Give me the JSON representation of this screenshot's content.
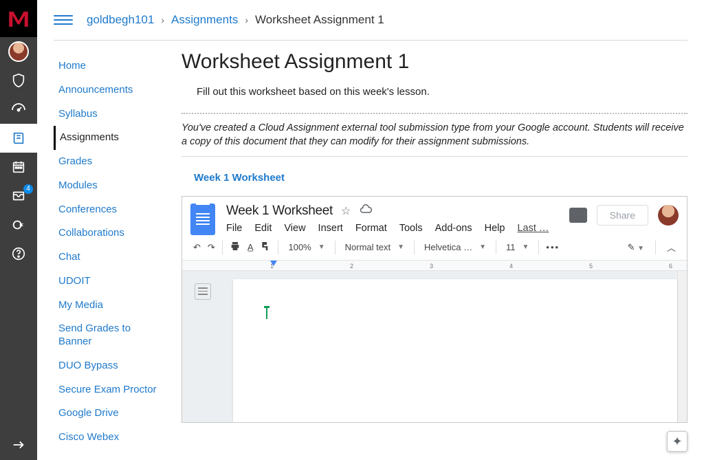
{
  "breadcrumb": {
    "course": "goldbegh101",
    "section": "Assignments",
    "page": "Worksheet Assignment 1"
  },
  "leftnav": {
    "items": [
      "Home",
      "Announcements",
      "Syllabus",
      "Assignments",
      "Grades",
      "Modules",
      "Conferences",
      "Collaborations",
      "Chat",
      "UDOIT",
      "My Media",
      "Send Grades to Banner",
      "DUO Bypass",
      "Secure Exam Proctor",
      "Google Drive",
      "Cisco Webex"
    ],
    "active_index": 3
  },
  "page": {
    "title": "Worksheet Assignment 1",
    "description": "Fill out this worksheet based on this week's lesson.",
    "cloud_note": "You've created a Cloud Assignment external tool submission type from your Google account. Students will receive a copy of this document that they can modify for their assignment submissions.",
    "doc_link_label": "Week 1 Worksheet"
  },
  "gdoc": {
    "title": "Week 1 Worksheet",
    "menus": [
      "File",
      "Edit",
      "View",
      "Insert",
      "Format",
      "Tools",
      "Add-ons",
      "Help",
      "Last …"
    ],
    "share_label": "Share",
    "toolbar": {
      "zoom": "100%",
      "style": "Normal text",
      "font": "Helvetica …",
      "size": "11"
    },
    "ruler_ticks": [
      "1",
      "2",
      "3",
      "4",
      "5",
      "6"
    ]
  },
  "rail": {
    "badge_count": "4"
  }
}
